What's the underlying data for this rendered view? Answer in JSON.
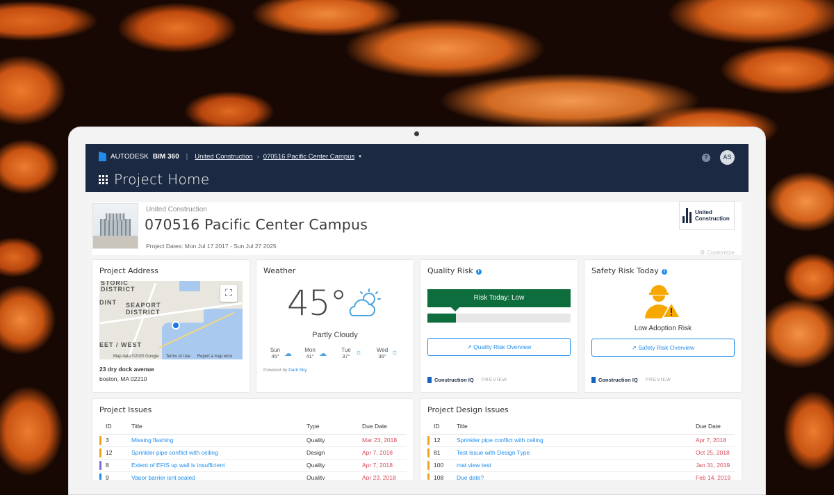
{
  "header": {
    "brand": "AUTODESK",
    "product": "BIM 360",
    "breadcrumb_company": "United Construction",
    "breadcrumb_project": "070516 Pacific Center Campus",
    "avatar_initials": "AS",
    "page_title": "Project Home"
  },
  "project": {
    "company": "United Construction",
    "name": "070516 Pacific Center Campus",
    "dates": "Project Dates: Mon Jul 17 2017 - Sun Jul 27 2025",
    "logo_text_1": "United",
    "logo_text_2": "Construction",
    "customize_label": "Customize"
  },
  "address_card": {
    "title": "Project Address",
    "map_labels": [
      "STORIC",
      "DISTRICT",
      "DINT",
      "SEAPORT",
      "DISTRICT",
      "EET / WEST"
    ],
    "map_footer": [
      "Map data ©2020 Google",
      "Terms of Use",
      "Report a map error"
    ],
    "street": "23 dry dock avenue",
    "city": "boston, MA 02210"
  },
  "weather_card": {
    "title": "Weather",
    "temperature": "45°",
    "condition": "Partly Cloudy",
    "forecast": [
      {
        "day": "Sun",
        "temp": "45°"
      },
      {
        "day": "Mon",
        "temp": "41°"
      },
      {
        "day": "Tue",
        "temp": "37°"
      },
      {
        "day": "Wed",
        "temp": "36°"
      }
    ],
    "powered_prefix": "Powered by",
    "powered_source": "Dark Sky"
  },
  "quality_card": {
    "title": "Quality Risk",
    "risk_label": "Risk Today: Low",
    "risk_level": 0.2,
    "button_label": "Quality Risk Overview",
    "footer_brand": "Construction IQ",
    "footer_tag": "PREVIEW"
  },
  "safety_card": {
    "title": "Safety Risk Today",
    "risk_label": "Low Adoption Risk",
    "button_label": "Safety Risk Overview",
    "footer_brand": "Construction IQ",
    "footer_tag": "PREVIEW"
  },
  "issues": {
    "title": "Project Issues",
    "columns": [
      "ID",
      "Title",
      "Type",
      "Due Date"
    ],
    "rows": [
      {
        "id": "3",
        "title": "Missing flashing",
        "type": "Quality",
        "due": "Mar 23, 2018",
        "color": "#f2a21b"
      },
      {
        "id": "12",
        "title": "Sprinkler pipe conflict with ceiling",
        "type": "Design",
        "due": "Apr 7, 2018",
        "color": "#f2a21b"
      },
      {
        "id": "8",
        "title": "Extent of EFIS up wall is insufficient",
        "type": "Quality",
        "due": "Apr 7, 2018",
        "color": "#7b6fd6"
      },
      {
        "id": "9",
        "title": "Vapor barrier isnt sealed",
        "type": "Quality",
        "due": "Apr 23, 2018",
        "color": "#1f8ceb"
      }
    ]
  },
  "design_issues": {
    "title": "Project Design Issues",
    "columns": [
      "ID",
      "Title",
      "Due Date"
    ],
    "rows": [
      {
        "id": "12",
        "title": "Sprinkler pipe conflict with ceiling",
        "due": "Apr 7, 2018",
        "color": "#f2a21b"
      },
      {
        "id": "81",
        "title": "Test Issue with Design Type",
        "due": "Oct 25, 2018",
        "color": "#f2a21b"
      },
      {
        "id": "100",
        "title": "mat view test",
        "due": "Jan 31, 2019",
        "color": "#f2a21b"
      },
      {
        "id": "108",
        "title": "Due date?",
        "due": "Feb 14, 2019",
        "color": "#f2a21b"
      }
    ]
  }
}
